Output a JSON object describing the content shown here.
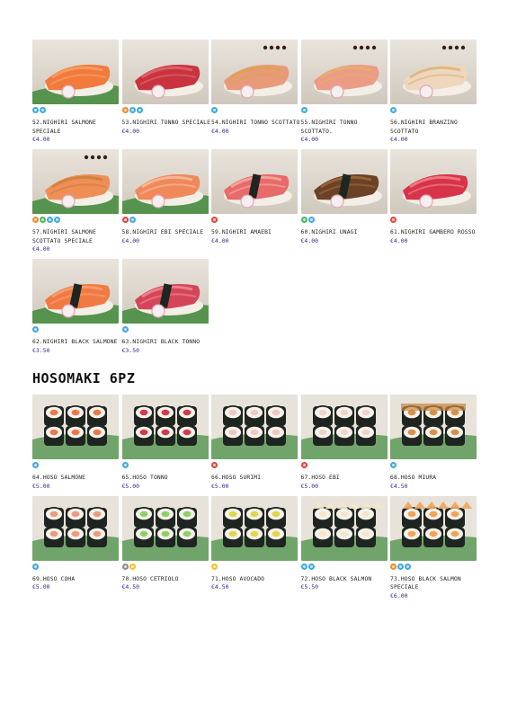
{
  "colors": {
    "price": "#2b2b9a",
    "blue": "#3fa9e0",
    "orange": "#f08a24",
    "green": "#49b85a",
    "red": "#e2453c",
    "gray": "#8c8c8c",
    "yellow": "#f2c12e"
  },
  "nighiri_items": [
    {
      "name": "52.NIGHIRI SALMONE SPECIALE",
      "price": "€4.00",
      "allergens": [
        "blue",
        "blue"
      ],
      "photo": "salmon-flower"
    },
    {
      "name": "53.NIGHIRI TONNO SPECIALE",
      "price": "€4.00",
      "allergens": [
        "orange",
        "blue",
        "blue"
      ],
      "photo": "tuna-topped"
    },
    {
      "name": "54.NIGHIRI TONNO SCOTTATO",
      "price": "€4.00",
      "allergens": [
        "blue"
      ],
      "photo": "seared-tuna"
    },
    {
      "name": "55.NIGHIRI TONNO SCOTTATO.",
      "price": "€4.00",
      "allergens": [
        "blue"
      ],
      "photo": "seared-tuna-roe"
    },
    {
      "name": "56.NIGHIRI BRANZINO SCOTTATO",
      "price": "€4.00",
      "allergens": [
        "blue"
      ],
      "photo": "seabass"
    },
    {
      "name": "57.NIGHIRI SALMONE SCOTTATO SPECIALE",
      "price": "€4.00",
      "allergens": [
        "orange",
        "green",
        "blue",
        "blue"
      ],
      "photo": "seared-salmon-leaf"
    },
    {
      "name": "58.NIGHIRI EBI SPECIALE",
      "price": "€4.00",
      "allergens": [
        "red",
        "blue"
      ],
      "photo": "ebi"
    },
    {
      "name": "59.NIGHIRI AMAEBI",
      "price": "€4.00",
      "allergens": [
        "red"
      ],
      "photo": "amaebi"
    },
    {
      "name": "60.NIGHIRI UNAGI",
      "price": "€4.00",
      "allergens": [
        "green",
        "blue"
      ],
      "photo": "unagi"
    },
    {
      "name": "61.NIGHIRI GAMBERO ROSSO",
      "price": "€4.00",
      "allergens": [
        "red"
      ],
      "photo": "red-prawn"
    },
    {
      "name": "62.NIGHIRI BLACK SALMONE",
      "price": "€3.50",
      "allergens": [
        "blue"
      ],
      "photo": "black-salmon"
    },
    {
      "name": "63.NIGHIRI BLACK TONNO",
      "price": "€3.50",
      "allergens": [
        "blue"
      ],
      "photo": "black-tuna"
    }
  ],
  "hosomaki_heading": "HOSOMAKI 6PZ",
  "hosomaki_items": [
    {
      "name": "64.HOSO SALMONE",
      "price": "€5.00",
      "allergens": [
        "blue"
      ],
      "fill": "#f0774a"
    },
    {
      "name": "65.HOSO TONNO",
      "price": "€5.00",
      "allergens": [
        "blue"
      ],
      "fill": "#d43a4a"
    },
    {
      "name": "66.HOSO SURIMI",
      "price": "€5.00",
      "allergens": [
        "red"
      ],
      "fill": "#f3c6c0"
    },
    {
      "name": "67.HOSO EBI",
      "price": "€5.00",
      "allergens": [
        "red"
      ],
      "fill": "#f1d4c8"
    },
    {
      "name": "68.HOSO MIURA",
      "price": "€4.50",
      "allergens": [
        "blue"
      ],
      "fill": "#d9904a"
    },
    {
      "name": "69.HOSO COHA",
      "price": "€5.00",
      "allergens": [
        "blue"
      ],
      "fill": "#e89d7f"
    },
    {
      "name": "70.HOSO CETRIOLO",
      "price": "€4.50",
      "allergens": [
        "gray",
        "yellow"
      ],
      "fill": "#8fcf6a"
    },
    {
      "name": "71.HOSO AVOCADO",
      "price": "€4.50",
      "allergens": [
        "yellow"
      ],
      "fill": "#e0d64a"
    },
    {
      "name": "72.HOSO BLACK SALMON",
      "price": "€5.50",
      "allergens": [
        "blue",
        "blue"
      ],
      "fill": "#f4e7c8"
    },
    {
      "name": "73.HOSO BLACK SALMON SPECIALE",
      "price": "€6.00",
      "allergens": [
        "orange",
        "blue",
        "blue"
      ],
      "fill": "#f2a35a"
    }
  ]
}
